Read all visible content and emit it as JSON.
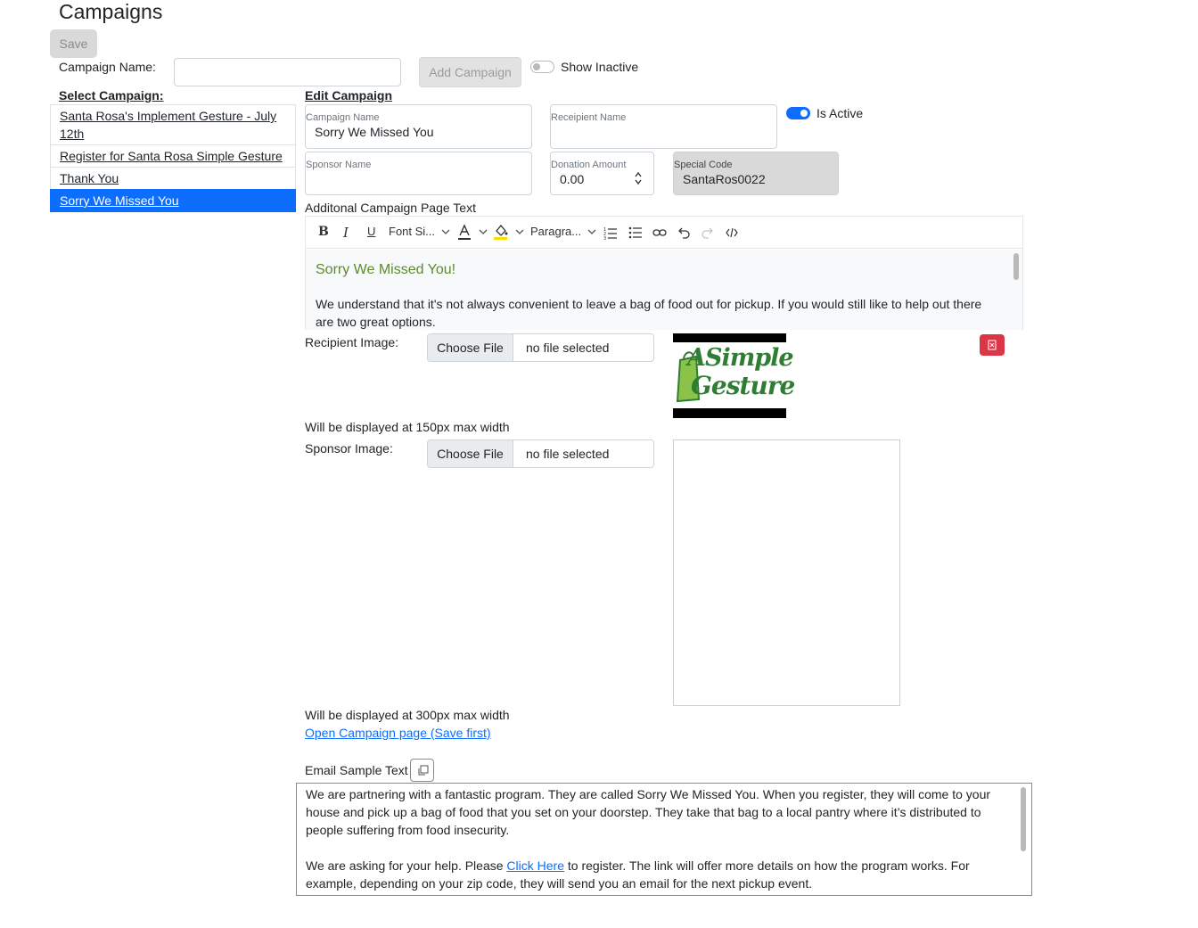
{
  "page": {
    "title": "Campaigns"
  },
  "toolbar": {
    "save_label": "Save"
  },
  "add_form": {
    "name_label": "Campaign Name:",
    "name_value": "",
    "add_label": "Add Campaign",
    "show_inactive_label": "Show Inactive",
    "show_inactive_on": false
  },
  "select_panel": {
    "heading": "Select Campaign:",
    "items": [
      {
        "label": "Santa Rosa's Implement Gesture - July 12th",
        "active": false
      },
      {
        "label": "Register for Santa Rosa Simple Gesture",
        "active": false
      },
      {
        "label": "Thank You",
        "active": false
      },
      {
        "label": "Sorry We Missed You",
        "active": true
      }
    ]
  },
  "edit_panel": {
    "heading": "Edit Campaign",
    "campaign_name": {
      "label": "Campaign Name",
      "value": "Sorry We Missed You"
    },
    "recipient_name": {
      "label": "Receipient Name",
      "value": ""
    },
    "is_active_label": "Is Active",
    "is_active_on": true,
    "sponsor_name": {
      "label": "Sponsor Name",
      "value": ""
    },
    "donation_amount": {
      "label": "Donation Amount",
      "value": "0.00"
    },
    "special_code": {
      "label": "Special Code",
      "value": "SantaRos0022"
    },
    "page_text_label": "Additonal Campaign Page Text",
    "editor": {
      "font_size_label": "Font Si...",
      "paragraph_label": "Paragra...",
      "heading_color": "#5a8a2e",
      "heading": "Sorry We Missed You!",
      "body": "We understand that it's not always convenient to leave a bag of food out for pickup.   If you would still like to help out there are two great options."
    },
    "recipient_image": {
      "label": "Recipient Image:",
      "choose_label": "Choose File",
      "file_status": "no file selected",
      "note": "Will be displayed at 150px max width",
      "logo_text_line1": "ASimple",
      "logo_text_line2": "Gesture"
    },
    "sponsor_image": {
      "label": "Sponsor Image:",
      "choose_label": "Choose File",
      "file_status": "no file selected",
      "note": "Will be displayed at 300px max width"
    },
    "open_page_link": "Open Campaign page (Save first)",
    "email_sample": {
      "label": "Email Sample Text",
      "para1": "We are partnering with a fantastic program. They are called Sorry We Missed You. When you register, they will come to your house and pick up a bag of food that you set on your doorstep. They take that bag to a local pantry where it’s distributed to people suffering from food insecurity.",
      "para2_before": "We are asking for your help. Please ",
      "para2_link": "Click Here",
      "para2_after": " to register. The link will offer more details on how the program works. For example, depending on your zip code, they will send you an email for the next pickup event."
    }
  },
  "colors": {
    "accent": "#0d6efd",
    "danger": "#dc3545",
    "logo_green": "#2e7d32"
  }
}
